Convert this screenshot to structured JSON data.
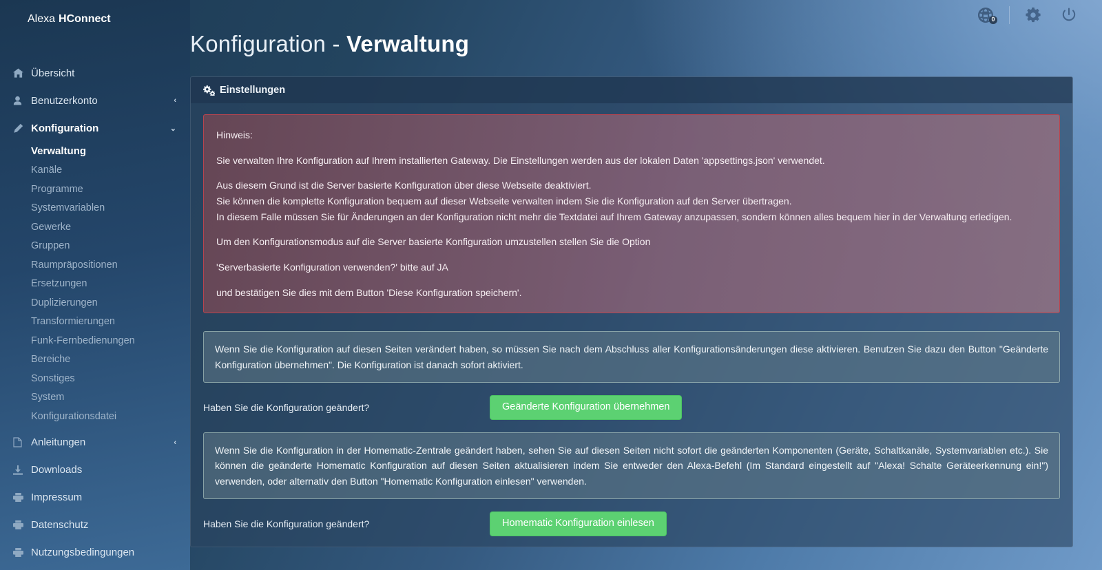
{
  "brand": {
    "light": "Alexa",
    "bold": "HConnect"
  },
  "topbar": {
    "globe_icon": "globe-icon",
    "globe_badge": "0",
    "settings_icon": "gear-icon",
    "power_icon": "power-icon"
  },
  "sidebar": {
    "items": [
      {
        "label": "Übersicht",
        "icon": "home-icon",
        "caret": "",
        "active": false
      },
      {
        "label": "Benutzerkonto",
        "icon": "user-icon",
        "caret": "‹",
        "active": false
      },
      {
        "label": "Konfiguration",
        "icon": "pencil-icon",
        "caret": "⌄",
        "active": true
      }
    ],
    "subitems": [
      {
        "label": "Verwaltung",
        "active": true
      },
      {
        "label": "Kanäle",
        "active": false
      },
      {
        "label": "Programme",
        "active": false
      },
      {
        "label": "Systemvariablen",
        "active": false
      },
      {
        "label": "Gewerke",
        "active": false
      },
      {
        "label": "Gruppen",
        "active": false
      },
      {
        "label": "Raumpräpositionen",
        "active": false
      },
      {
        "label": "Ersetzungen",
        "active": false
      },
      {
        "label": "Duplizierungen",
        "active": false
      },
      {
        "label": "Transformierungen",
        "active": false
      },
      {
        "label": "Funk-Fernbedienungen",
        "active": false
      },
      {
        "label": "Bereiche",
        "active": false
      },
      {
        "label": "Sonstiges",
        "active": false
      },
      {
        "label": "System",
        "active": false
      },
      {
        "label": "Konfigurationsdatei",
        "active": false
      }
    ],
    "bottom_items": [
      {
        "label": "Anleitungen",
        "icon": "pdf-file-icon",
        "caret": "‹"
      },
      {
        "label": "Downloads",
        "icon": "download-icon",
        "caret": ""
      },
      {
        "label": "Impressum",
        "icon": "print-icon",
        "caret": ""
      },
      {
        "label": "Datenschutz",
        "icon": "print-icon",
        "caret": ""
      },
      {
        "label": "Nutzungsbedingungen",
        "icon": "print-icon",
        "caret": ""
      }
    ]
  },
  "page": {
    "title_light": "Konfiguration -",
    "title_bold": "Verwaltung"
  },
  "panel": {
    "header": "Einstellungen",
    "header_icon": "cogs-icon"
  },
  "alert_danger": {
    "line1": "Hinweis:",
    "line2": "Sie verwalten Ihre Konfiguration auf Ihrem installierten Gateway. Die Einstellungen werden aus der lokalen Daten 'appsettings.json' verwendet.",
    "line3a": "Aus diesem Grund ist die Server basierte Konfiguration über diese Webseite deaktiviert.",
    "line3b": "Sie können die komplette Konfiguration bequem auf dieser Webseite verwalten indem Sie die Konfiguration auf den Server übertragen.",
    "line3c": "In diesem Falle müssen Sie für Änderungen an der Konfiguration nicht mehr die Textdatei auf Ihrem Gateway anzupassen, sondern können alles bequem hier in der Verwaltung erledigen.",
    "line4": "Um den Konfigurationsmodus auf die Server basierte Konfiguration umzustellen stellen Sie die Option",
    "line5": "'Serverbasierte Konfiguration verwenden?' bitte auf JA",
    "line6": "und bestätigen Sie dies mit dem Button 'Diese Konfiguration speichern'."
  },
  "info_box_1": {
    "text": "Wenn Sie die Konfiguration auf diesen Seiten verändert haben, so müssen Sie nach dem Abschluss aller Konfigurationsänderungen diese aktivieren. Benutzen Sie dazu den Button \"Geänderte Konfiguration übernehmen\". Die Konfiguration ist danach sofort aktiviert."
  },
  "row_1": {
    "question": "Haben Sie die Konfiguration geändert?",
    "button": "Geänderte Konfiguration übernehmen"
  },
  "info_box_2": {
    "text": "Wenn Sie die Konfiguration in der Homematic-Zentrale geändert haben, sehen Sie auf diesen Seiten nicht sofort die geänderten Komponenten (Geräte, Schaltkanäle, Systemvariablen etc.). Sie können die geänderte Homematic Konfiguration auf diesen Seiten aktualisieren indem Sie entweder den Alexa-Befehl (Im Standard eingestellt auf \"Alexa! Schalte Geräteerkennung ein!\") verwenden, oder alternativ den Button \"Homematic Konfiguration einlesen\" verwenden."
  },
  "row_2": {
    "question": "Haben Sie die Konfiguration geändert?",
    "button": "Homematic Konfiguration einlesen"
  },
  "colors": {
    "accent_green": "#5cd172",
    "danger_border": "#b8444f",
    "sidebar_dark": "#1b3752",
    "panel_bg": "#2a4460"
  }
}
